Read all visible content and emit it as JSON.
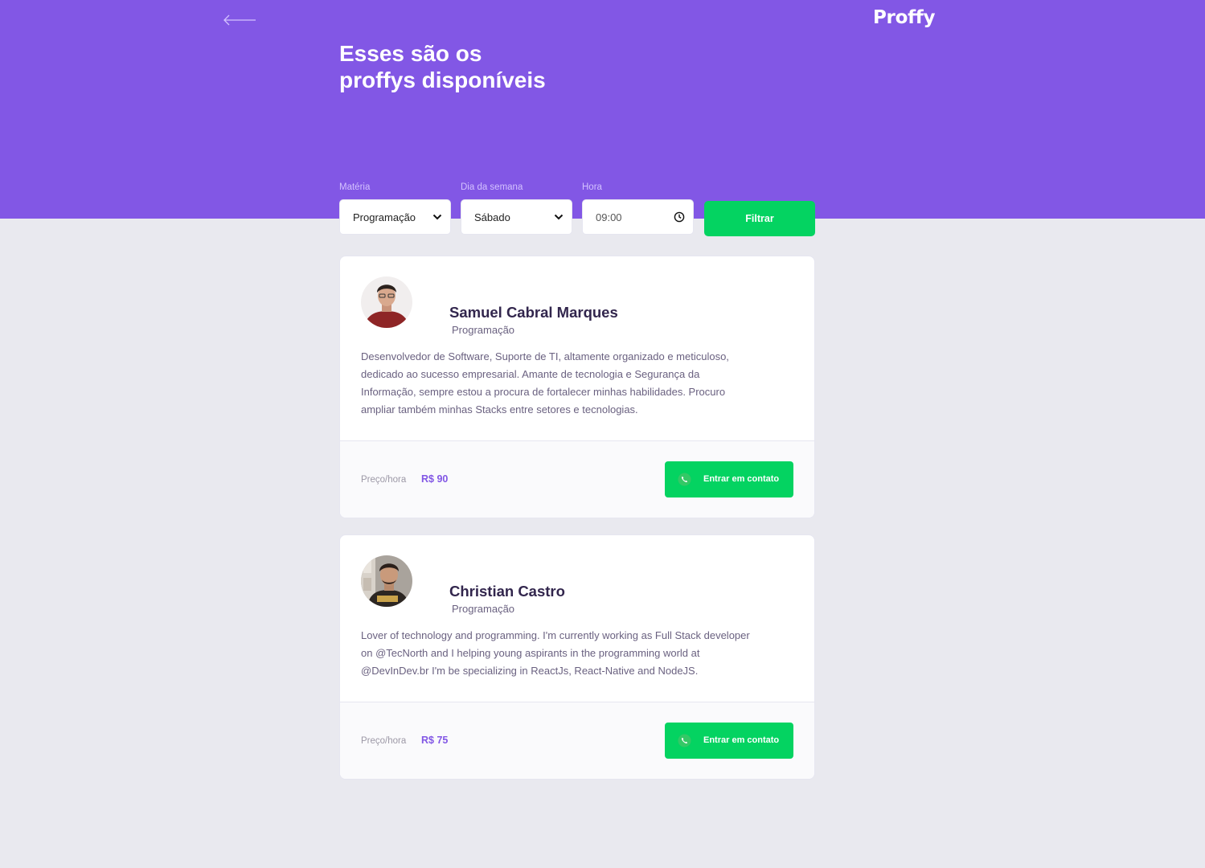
{
  "header": {
    "logo": "Proffy",
    "title_line1": "Esses são os",
    "title_line2": "proffys disponíveis"
  },
  "filters": {
    "subject": {
      "label": "Matéria",
      "value": "Programação"
    },
    "weekday": {
      "label": "Dia da semana",
      "value": "Sábado"
    },
    "time": {
      "label": "Hora",
      "value": "09:00"
    },
    "submit_label": "Filtrar"
  },
  "teachers": [
    {
      "name": "Samuel Cabral Marques",
      "subject": "Programação",
      "bio_lines": [
        "Desenvolvedor de Software, Suporte de TI, altamente organizado e meticuloso,",
        "dedicado ao sucesso empresarial. Amante de tecnologia e Segurança da",
        "Informação, sempre estou a procura de fortalecer minhas habilidades. Procuro",
        "ampliar também minhas Stacks entre setores e tecnologias."
      ],
      "price_label": "Preço/hora",
      "price": "R$ 90",
      "contact_label": "Entrar em contato"
    },
    {
      "name": "Christian Castro",
      "subject": "Programação",
      "bio_lines": [
        "Lover of technology and programming. I'm currently working as Full Stack developer",
        "on @TecNorth and I helping young aspirants in the programming world at",
        "@DevInDev.br I'm be specializing in ReactJs, React-Native and NodeJS."
      ],
      "price_label": "Preço/hora",
      "price": "R$ 75",
      "contact_label": "Entrar em contato"
    }
  ],
  "colors": {
    "primary": "#8257e5",
    "secondary": "#04d361",
    "background": "#e9e9ef",
    "title_text": "#32264d",
    "body_text": "#6a6180"
  },
  "icons": {
    "back": "arrow-left-icon",
    "contact": "whatsapp-icon",
    "time": "clock-icon",
    "select": "chevron-down-icon"
  }
}
